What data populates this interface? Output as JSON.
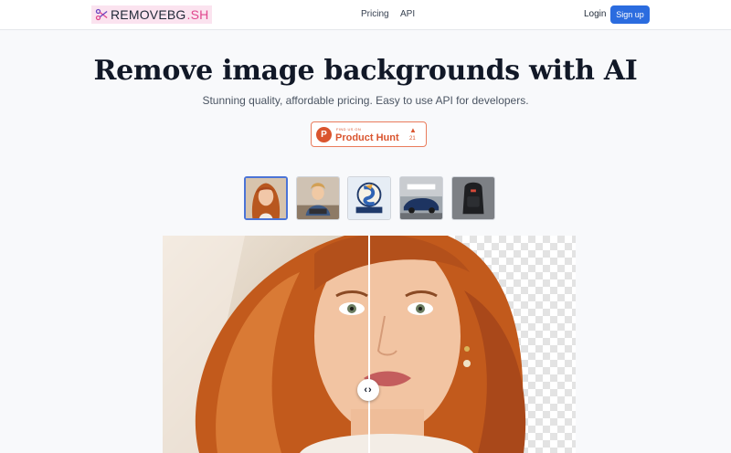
{
  "header": {
    "logo_main": "REMOVEBG",
    "logo_suffix": ".SH",
    "nav": [
      "Pricing",
      "API"
    ],
    "login": "Login",
    "signup": "Sign up"
  },
  "hero": {
    "title": "Remove image backgrounds with AI",
    "subtitle": "Stunning quality, affordable pricing. Easy to use API for developers."
  },
  "product_hunt": {
    "small": "FIND US ON",
    "name": "Product Hunt",
    "count": "21",
    "letter": "P",
    "arrow": "▲"
  },
  "thumbnails": [
    {
      "name": "woman-red-hair",
      "selected": true
    },
    {
      "name": "woman-laptop",
      "selected": false
    },
    {
      "name": "fishing-logo",
      "selected": false
    },
    {
      "name": "tesla-car",
      "selected": false
    },
    {
      "name": "backpack",
      "selected": false
    }
  ],
  "comparison": {
    "handle_glyph": "‹›"
  },
  "colors": {
    "accent": "#2b6cdf",
    "brand_pink": "#e0478e",
    "product_hunt": "#da552f"
  },
  "icons": [
    "scissors-icon",
    "product-hunt-icon",
    "upvote-arrow-icon",
    "compare-handle-icon"
  ]
}
